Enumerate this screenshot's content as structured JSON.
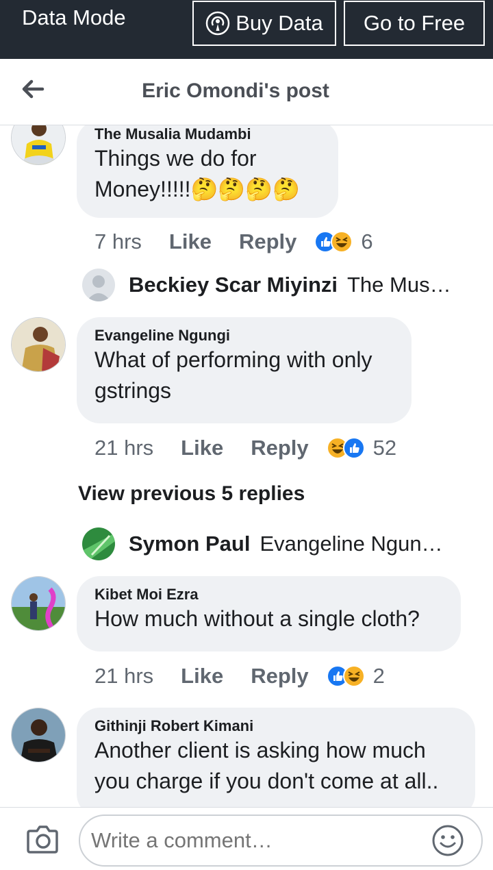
{
  "databar": {
    "mode_label": "Data Mode",
    "buy_label": "Buy Data",
    "free_label": "Go to Free"
  },
  "header": {
    "title": "Eric Omondi's post"
  },
  "comments": [
    {
      "author": "The Musalia Mudambi",
      "text_line1": "Things we do for",
      "text_line2": "Money!!!!!🤔🤔🤔🤔",
      "time": "7 hrs",
      "like": "Like",
      "reply": "Reply",
      "reaction_count": "6"
    },
    {
      "author": "Evangeline Ngungi",
      "text_line1": "What of performing with only",
      "text_line2": "gstrings",
      "time": "21 hrs",
      "like": "Like",
      "reply": "Reply",
      "reaction_count": "52"
    },
    {
      "author": "Kibet Moi Ezra",
      "text_line1": "How much without a single cloth?",
      "time": "21 hrs",
      "like": "Like",
      "reply": "Reply",
      "reaction_count": "2"
    },
    {
      "author": "Githinji Robert Kimani",
      "text_line1": "Another client is asking how much",
      "text_line2": "you charge if you don't come at all.."
    }
  ],
  "replies": [
    {
      "name": "Beckiey Scar Miyinzi",
      "text": "The Mus…"
    },
    {
      "name": "Symon Paul",
      "text": "Evangeline Ngun…"
    }
  ],
  "view_previous": "View previous 5 replies",
  "composer": {
    "placeholder": "Write a comment…"
  },
  "colors": {
    "databar_bg": "#232a33",
    "bubble_bg": "#eff1f4",
    "like_blue": "#1877f2",
    "haha_yellow": "#f7b125"
  }
}
